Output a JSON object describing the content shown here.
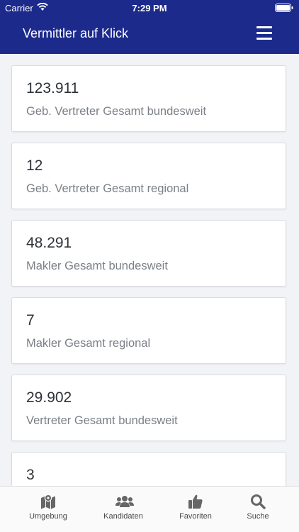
{
  "status": {
    "carrier": "Carrier",
    "time": "7:29 PM"
  },
  "header": {
    "title": "Vermittler auf Klick"
  },
  "stats": [
    {
      "value": "123.911",
      "label": "Geb. Vertreter Gesamt bundesweit"
    },
    {
      "value": "12",
      "label": "Geb. Vertreter Gesamt regional"
    },
    {
      "value": "48.291",
      "label": "Makler Gesamt bundesweit"
    },
    {
      "value": "7",
      "label": "Makler Gesamt regional"
    },
    {
      "value": "29.902",
      "label": "Vertreter Gesamt bundesweit"
    },
    {
      "value": "3",
      "label": ""
    }
  ],
  "tabs": [
    {
      "label": "Umgebung",
      "icon": "map-icon"
    },
    {
      "label": "Kandidaten",
      "icon": "users-icon"
    },
    {
      "label": "Favoriten",
      "icon": "thumbs-up-icon"
    },
    {
      "label": "Suche",
      "icon": "search-icon"
    }
  ],
  "colors": {
    "primary": "#1c2a8b",
    "background": "#f2f3f7",
    "card": "#ffffff",
    "label": "#7b8087"
  }
}
